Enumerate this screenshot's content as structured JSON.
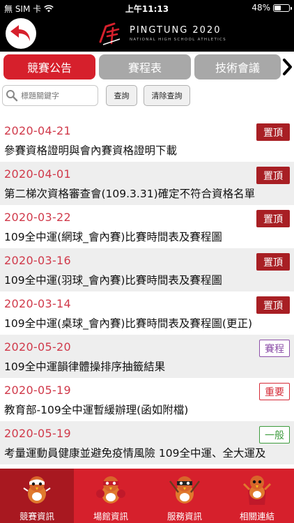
{
  "status_bar": {
    "carrier": "無 SIM 卡",
    "time": "上午11:13",
    "battery": "48%",
    "battery_level": 0.48
  },
  "header": {
    "logo_title": "PINGTUNG 2020",
    "logo_subtitle": "NATIONAL HIGH SCHOOL ATHLETICS",
    "back_icon": "back-arrow-icon"
  },
  "tabs": [
    {
      "label": "競賽公告",
      "active": true
    },
    {
      "label": "賽程表",
      "active": false
    },
    {
      "label": "技術會議",
      "active": false
    }
  ],
  "search": {
    "placeholder": "標題關鍵字",
    "query_button": "查詢",
    "clear_button": "清除查詢"
  },
  "announcements": [
    {
      "date": "2020-04-21",
      "title": "參賽資格證明與會內賽資格證明下載",
      "badge": "置頂",
      "badge_type": "top"
    },
    {
      "date": "2020-04-01",
      "title": "第二梯次資格審查會(109.3.31)確定不符合資格名單",
      "badge": "置頂",
      "badge_type": "top"
    },
    {
      "date": "2020-03-22",
      "title": "109全中運(網球_會內賽)比賽時間表及賽程圖",
      "badge": "置頂",
      "badge_type": "top"
    },
    {
      "date": "2020-03-16",
      "title": "109全中運(羽球_會內賽)比賽時間表及賽程圖",
      "badge": "置頂",
      "badge_type": "top"
    },
    {
      "date": "2020-03-14",
      "title": "109全中運(桌球_會內賽)比賽時間表及賽程圖(更正)",
      "badge": "置頂",
      "badge_type": "top"
    },
    {
      "date": "2020-05-20",
      "title": "109全中運韻律體操排序抽籤結果",
      "badge": "賽程",
      "badge_type": "schedule"
    },
    {
      "date": "2020-05-19",
      "title": "教育部-109全中運暫緩辦理(函如附檔)",
      "badge": "重要",
      "badge_type": "important"
    },
    {
      "date": "2020-05-19",
      "title": "考量運動員健康並避免疫情風險 109全中運、全大運及",
      "badge": "一般",
      "badge_type": "general"
    }
  ],
  "bottom_nav": [
    {
      "label": "競賽資訊",
      "active": true
    },
    {
      "label": "場館資訊",
      "active": false
    },
    {
      "label": "服務資訊",
      "active": false
    },
    {
      "label": "相關連結",
      "active": false
    }
  ],
  "colors": {
    "brand_red": "#d6202c",
    "badge_top": "#a81f24",
    "date_red": "#d0394a"
  }
}
